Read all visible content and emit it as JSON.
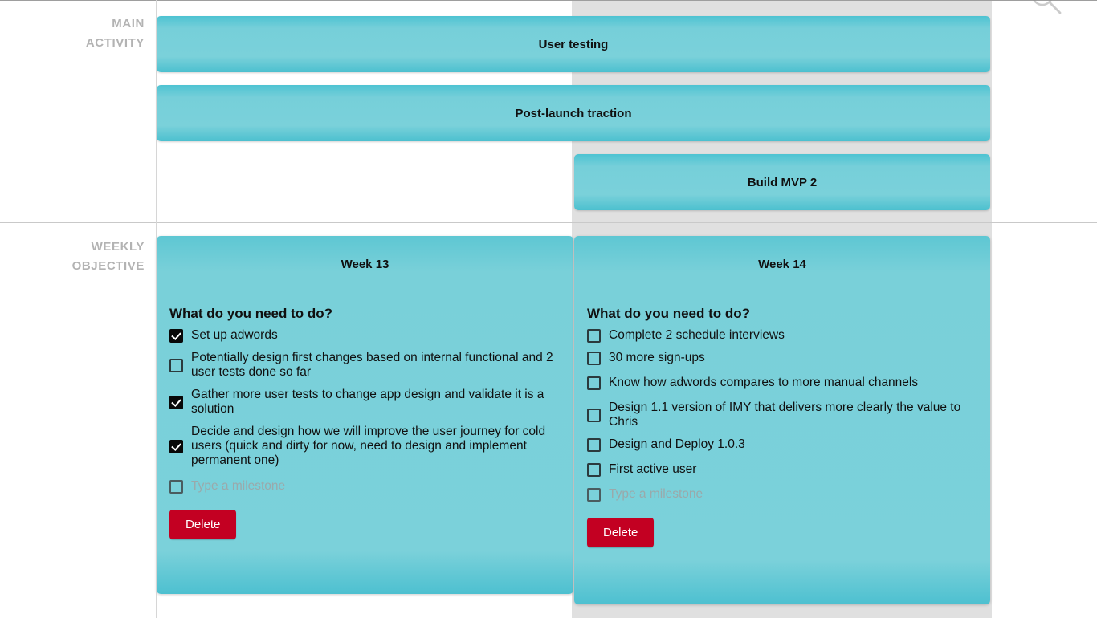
{
  "rows": {
    "main_activity_label": "MAIN\nACTIVITY",
    "main_activity_label_line1": "MAIN",
    "main_activity_label_line2": "ACTIVITY",
    "weekly_objective_label_line1": "WEEKLY",
    "weekly_objective_label_line2": "OBJECTIVE"
  },
  "colors": {
    "teal": "#7bd1da",
    "teal_edge": "#4cc0cf",
    "delete_red": "#c30022",
    "column_highlight": "#e0e0e0",
    "label_grey": "#b3b3b3",
    "placeholder_grey": "#9aa9ab"
  },
  "icons": {
    "search": "search-icon"
  },
  "main_activity": {
    "bars": [
      {
        "label": "User testing"
      },
      {
        "label": "Post-launch traction"
      },
      {
        "label": "Build MVP 2"
      }
    ]
  },
  "weekly_objective": {
    "prompt": "What do you need to do?",
    "delete_label": "Delete",
    "milestone_placeholder": "Type a milestone",
    "cards": [
      {
        "title": "Week 13",
        "milestones": [
          {
            "text": "Set up adwords",
            "checked": true
          },
          {
            "text": "Potentially design first changes based on internal functional and 2 user tests done so far",
            "checked": false
          },
          {
            "text": "Gather more user tests to change app design and validate it is a solution",
            "checked": true
          },
          {
            "text": "Decide and design how we will improve the user journey for cold users (quick and dirty for now, need to design and implement permanent one)",
            "checked": true
          }
        ]
      },
      {
        "title": "Week 14",
        "milestones": [
          {
            "text": "Complete 2 schedule interviews",
            "checked": false
          },
          {
            "text": "30 more sign-ups",
            "checked": false
          },
          {
            "text": "Know how adwords compares to more manual channels",
            "checked": false
          },
          {
            "text": "Design 1.1 version of IMY that delivers more clearly the value to Chris",
            "checked": false
          },
          {
            "text": "Design and Deploy 1.0.3",
            "checked": false
          },
          {
            "text": "First active user",
            "checked": false
          }
        ]
      }
    ]
  }
}
